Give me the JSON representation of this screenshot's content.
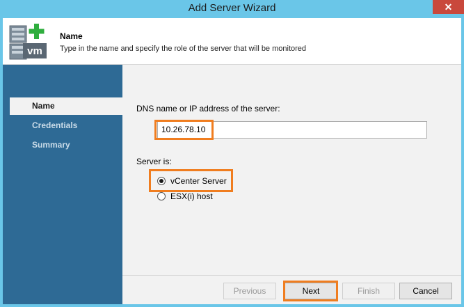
{
  "window": {
    "title": "Add Server Wizard",
    "close_glyph": "✕"
  },
  "header": {
    "title": "Name",
    "description": "Type in the name and specify the role of the server that will be monitored",
    "icon": "vm-server-add-icon",
    "icon_text": "vm"
  },
  "sidebar": {
    "items": [
      {
        "label": "Name",
        "active": true
      },
      {
        "label": "Credentials",
        "active": false
      },
      {
        "label": "Summary",
        "active": false
      }
    ]
  },
  "form": {
    "dns_label": "DNS name or IP address of the server:",
    "dns_value": "10.26.78.10",
    "server_is_label": "Server is:",
    "options": [
      {
        "label": "vCenter Server",
        "checked": true
      },
      {
        "label": "ESX(i) host",
        "checked": false
      }
    ]
  },
  "buttons": {
    "previous": "Previous",
    "next": "Next",
    "finish": "Finish",
    "cancel": "Cancel"
  },
  "colors": {
    "sidebar": "#2e6a95",
    "titlebar": "#6ac6e8",
    "highlight": "#f07d1f",
    "close": "#c9483c"
  }
}
